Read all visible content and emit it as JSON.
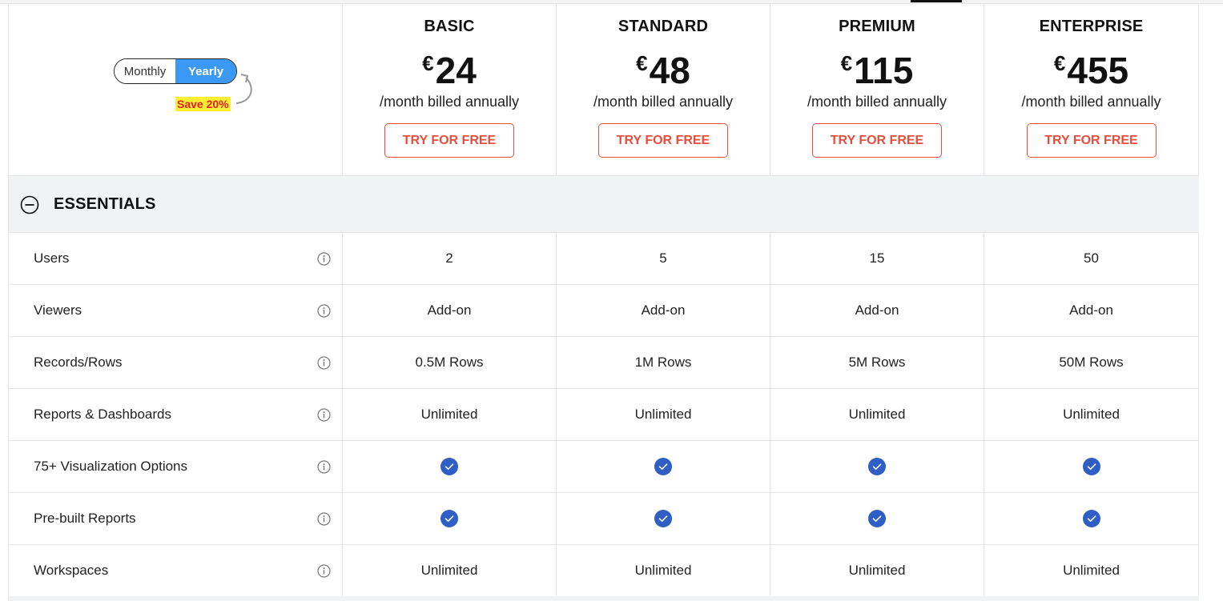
{
  "toggle": {
    "monthly": "Monthly",
    "yearly": "Yearly",
    "selected": "Yearly",
    "save": "Save 20%"
  },
  "plans": [
    {
      "name": "BASIC",
      "currency": "€",
      "price": "24",
      "billing": "/month billed annually",
      "cta": "TRY FOR FREE"
    },
    {
      "name": "STANDARD",
      "currency": "€",
      "price": "48",
      "billing": "/month billed annually",
      "cta": "TRY FOR FREE"
    },
    {
      "name": "PREMIUM",
      "currency": "€",
      "price": "115",
      "billing": "/month billed annually",
      "cta": "TRY FOR FREE"
    },
    {
      "name": "ENTERPRISE",
      "currency": "€",
      "price": "455",
      "billing": "/month billed annually",
      "cta": "TRY FOR FREE"
    }
  ],
  "section": {
    "title": "ESSENTIALS"
  },
  "rows": [
    {
      "label": "Users",
      "values": [
        "2",
        "5",
        "15",
        "50"
      ]
    },
    {
      "label": "Viewers",
      "values": [
        "Add-on",
        "Add-on",
        "Add-on",
        "Add-on"
      ]
    },
    {
      "label": "Records/Rows",
      "values": [
        "0.5M Rows",
        "1M Rows",
        "5M Rows",
        "50M Rows"
      ]
    },
    {
      "label": "Reports & Dashboards",
      "values": [
        "Unlimited",
        "Unlimited",
        "Unlimited",
        "Unlimited"
      ]
    },
    {
      "label": "75+ Visualization Options",
      "values": [
        "check-icon",
        "check-icon",
        "check-icon",
        "check-icon"
      ]
    },
    {
      "label": "Pre-built Reports",
      "values": [
        "check-icon",
        "check-icon",
        "check-icon",
        "check-icon"
      ]
    },
    {
      "label": "Workspaces",
      "values": [
        "Unlimited",
        "Unlimited",
        "Unlimited",
        "Unlimited"
      ]
    }
  ],
  "colors": {
    "accent": "#3a99f5",
    "cta": "#e84c3d",
    "check": "#2f5fc4",
    "section_bg": "#f1f2f4",
    "badge_bg": "#ffee33",
    "badge_text": "#e02020"
  }
}
